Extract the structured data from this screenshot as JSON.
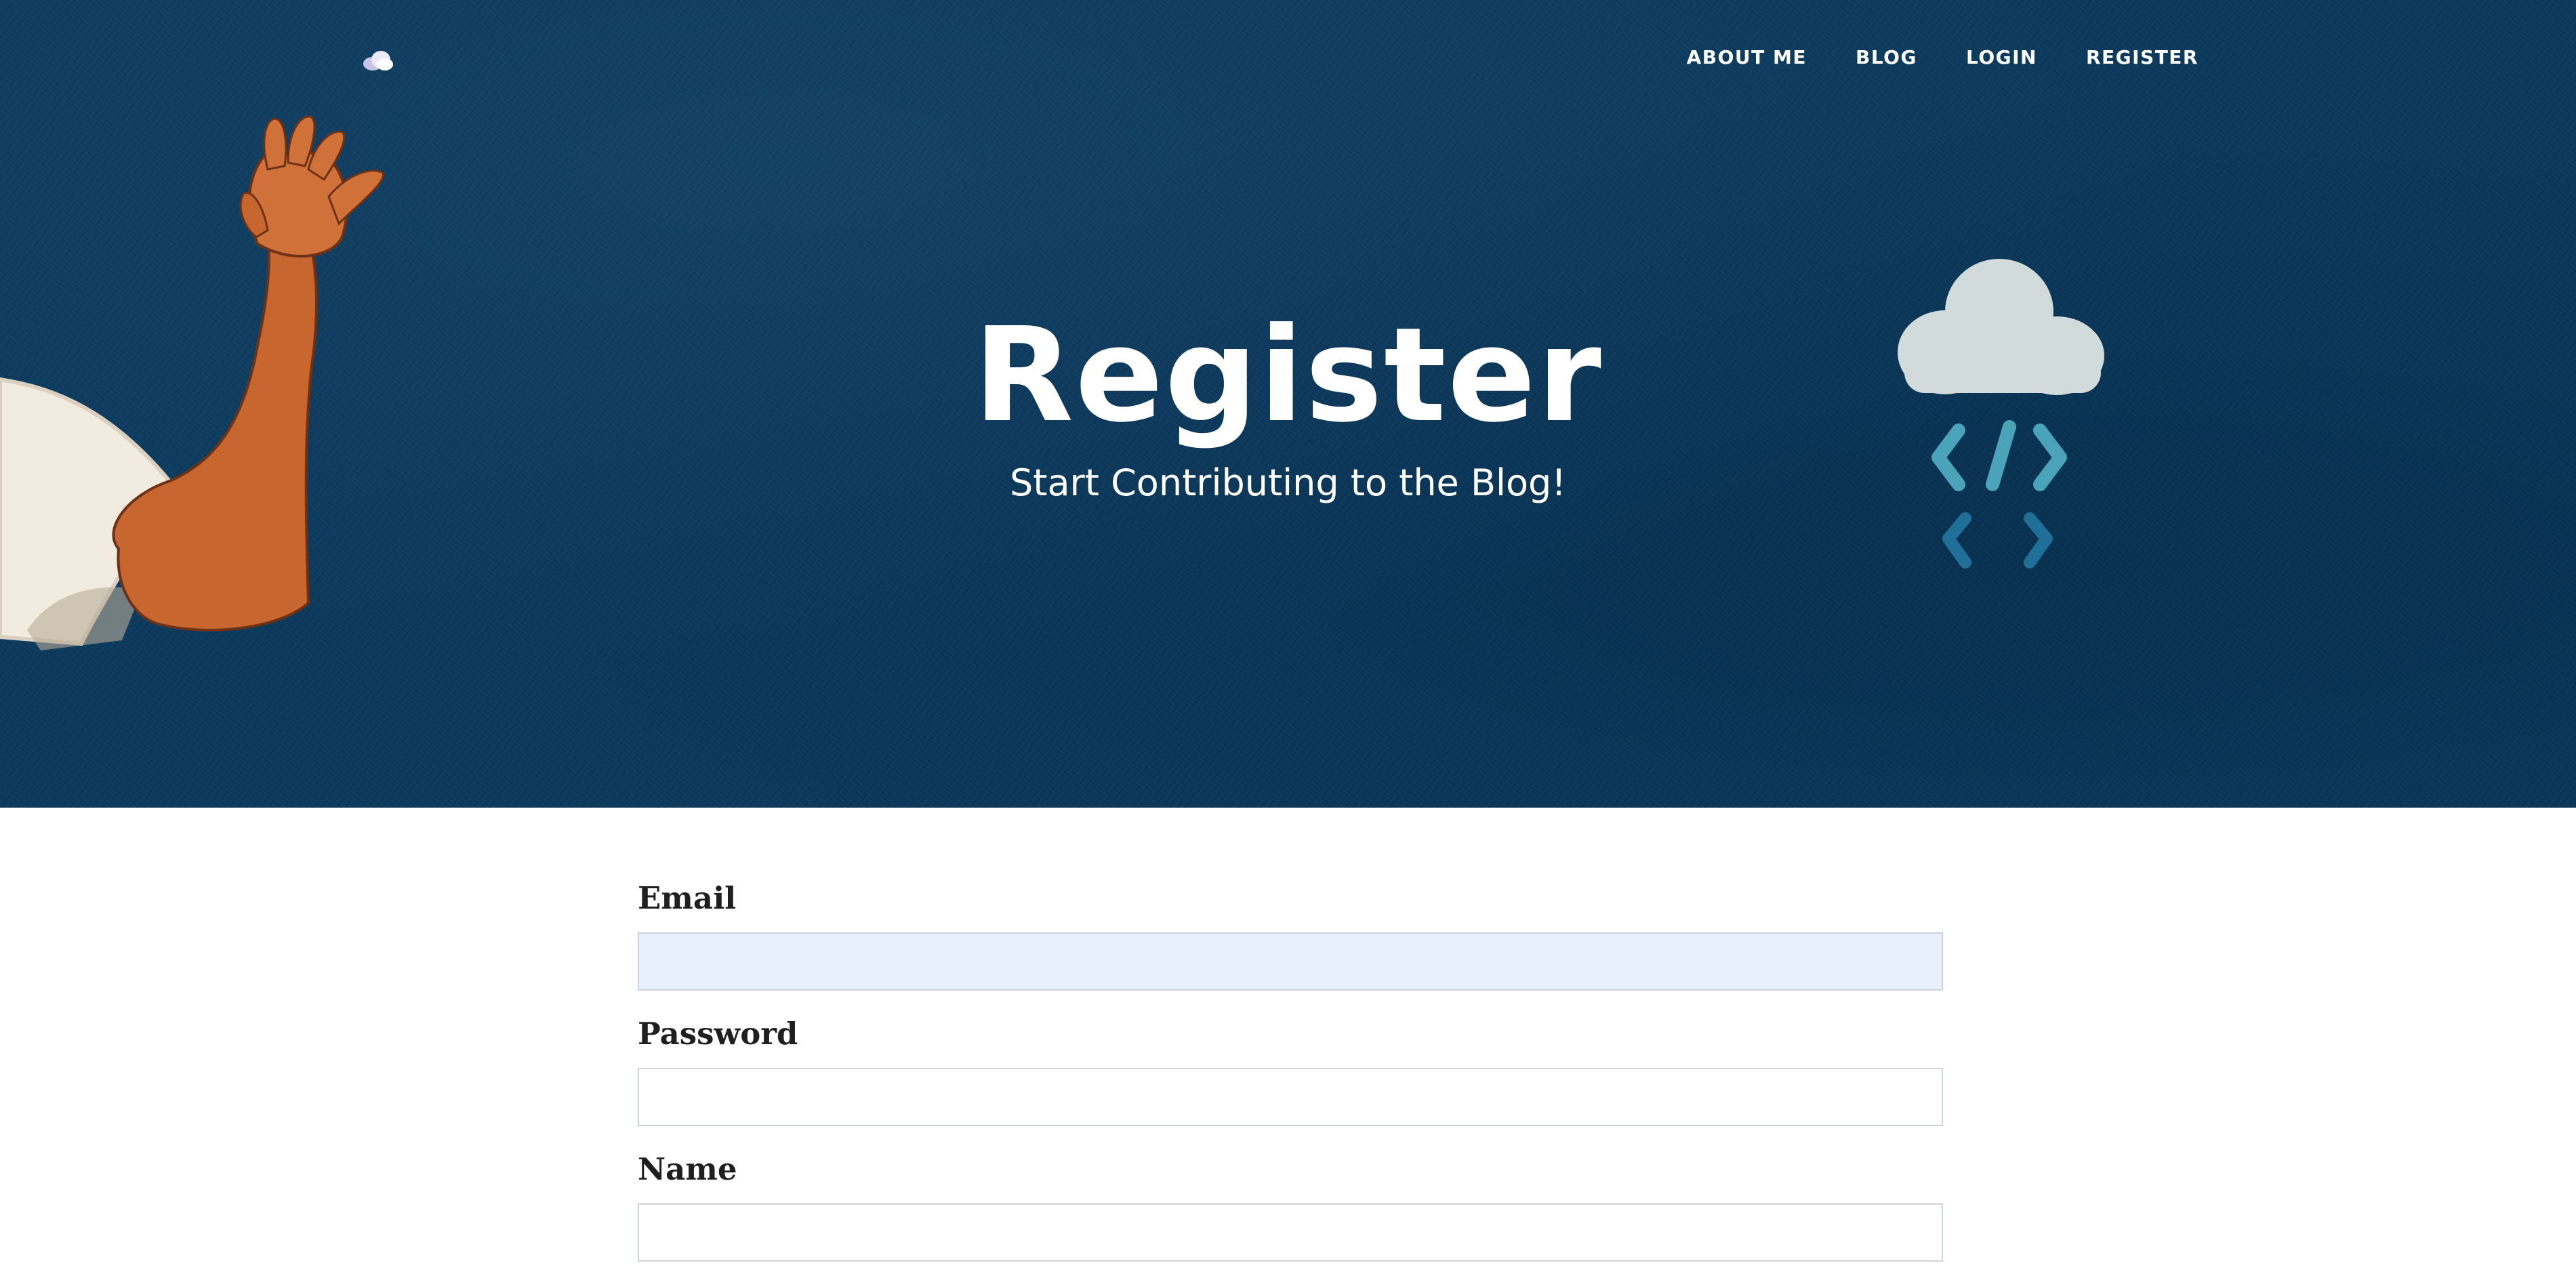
{
  "header": {
    "logo_icon": "cloud-icon",
    "nav": [
      {
        "label": "ABOUT ME"
      },
      {
        "label": "BLOG"
      },
      {
        "label": "LOGIN"
      },
      {
        "label": "REGISTER"
      }
    ]
  },
  "hero": {
    "title": "Register",
    "subtitle": "Start Contributing to the Blog!",
    "background_color": "#0c3a5c",
    "left_art_icon": "waving-hand-icon",
    "right_art_icon": "cloud-code-icon"
  },
  "form": {
    "fields": [
      {
        "label": "Email",
        "value": ""
      },
      {
        "label": "Password",
        "value": ""
      },
      {
        "label": "Name",
        "value": ""
      }
    ],
    "email_autofill_color": "#e8f0fe"
  }
}
